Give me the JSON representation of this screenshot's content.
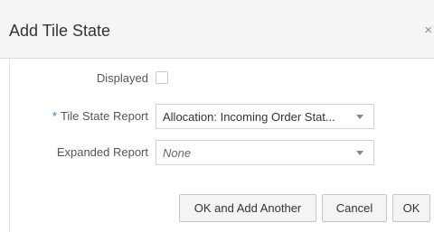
{
  "dialog": {
    "title": "Add Tile State",
    "close_glyph": "×"
  },
  "form": {
    "displayed": {
      "label": "Displayed",
      "checked": false
    },
    "tile_state_report": {
      "required_marker": "*",
      "label": "Tile State Report",
      "value": "Allocation: Incoming Order Stat..."
    },
    "expanded_report": {
      "label": "Expanded Report",
      "value": "None"
    }
  },
  "buttons": {
    "ok_add_another": "OK and Add Another",
    "cancel": "Cancel",
    "ok": "OK"
  },
  "icons": {
    "close": "close-icon",
    "dropdown": "chevron-down-icon"
  }
}
